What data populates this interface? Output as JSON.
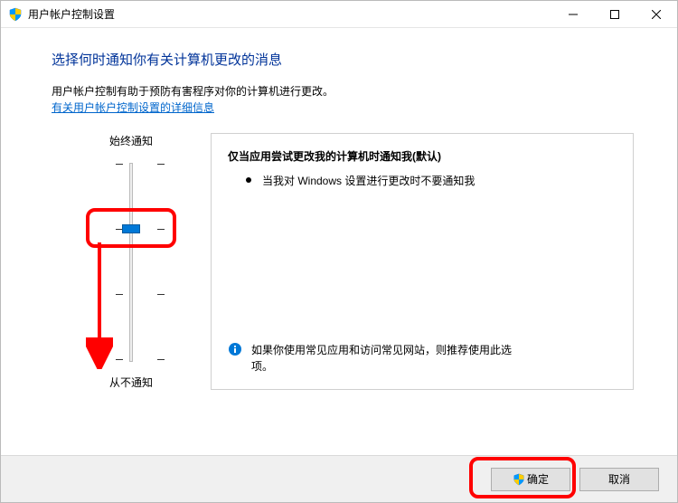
{
  "window": {
    "title": "用户帐户控制设置"
  },
  "heading": "选择何时通知你有关计算机更改的消息",
  "subtext": "用户帐户控制有助于预防有害程序对你的计算机进行更改。",
  "link": "有关用户帐户控制设置的详细信息",
  "slider": {
    "top_label": "始终通知",
    "bottom_label": "从不通知",
    "levels": 4,
    "current_level": 2
  },
  "description": {
    "title": "仅当应用尝试更改我的计算机时通知我(默认)",
    "bullet": "当我对 Windows 设置进行更改时不要通知我",
    "recommend": "如果你使用常见应用和访问常见网站，则推荐使用此选项。"
  },
  "buttons": {
    "ok": "确定",
    "cancel": "取消"
  }
}
